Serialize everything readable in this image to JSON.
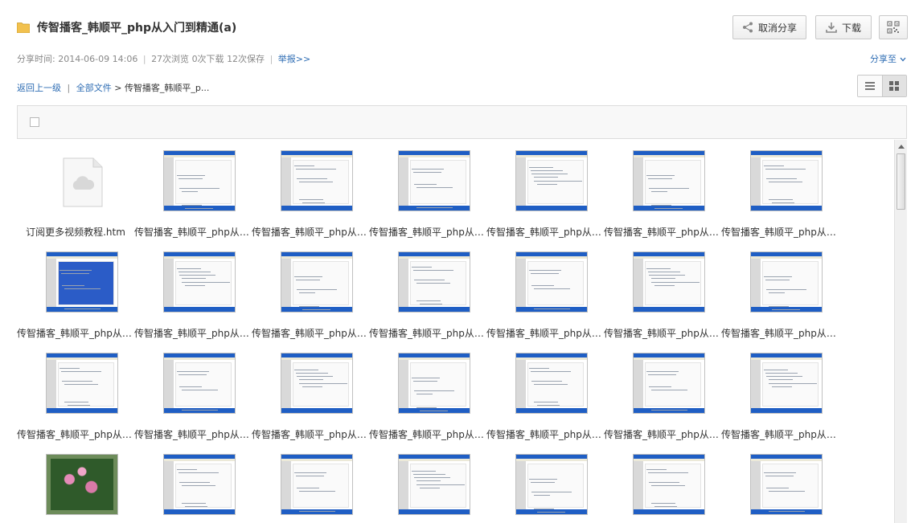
{
  "header": {
    "folder_icon": "folder-icon",
    "title": "传智播客_韩顺平_php从入门到精通(a)",
    "unshare_label": "取消分享",
    "download_label": "下载",
    "qr_icon": "qrcode-icon"
  },
  "meta": {
    "share_time_label": "分享时间:",
    "share_time": "2014-06-09 14:06",
    "views": "27次浏览",
    "downloads": "0次下载",
    "saves": "12次保存",
    "report": "举报>>",
    "share_to": "分享至"
  },
  "breadcrumb": {
    "back": "返回上一级",
    "all_files": "全部文件",
    "arrow": ">",
    "current": "传智播客_韩顺平_p..."
  },
  "colors": {
    "link": "#2d6cb3",
    "folder": "#f2c14e",
    "window_title": "#1f5ec4"
  },
  "files": [
    {
      "name": "订阅更多视频教程.htm",
      "kind": "doc"
    },
    {
      "name": "传智播客_韩顺平_php从入门到精通",
      "kind": "thumb"
    },
    {
      "name": "传智播客_韩顺平_php从入门到精通",
      "kind": "thumb"
    },
    {
      "name": "传智播客_韩顺平_php从入门到精通",
      "kind": "thumb"
    },
    {
      "name": "传智播客_韩顺平_php从入门到精通",
      "kind": "thumb"
    },
    {
      "name": "传智播客_韩顺平_php从入门到精通",
      "kind": "thumb"
    },
    {
      "name": "传智播客_韩顺平_php从入门到精通",
      "kind": "thumb"
    },
    {
      "name": "传智播客_韩顺平_php从入门到精通",
      "kind": "highlight"
    },
    {
      "name": "传智播客_韩顺平_php从入门到精通",
      "kind": "thumb"
    },
    {
      "name": "传智播客_韩顺平_php从入门到精通",
      "kind": "thumb"
    },
    {
      "name": "传智播客_韩顺平_php从入门到精通",
      "kind": "thumb"
    },
    {
      "name": "传智播客_韩顺平_php从入门到精通",
      "kind": "thumb"
    },
    {
      "name": "传智播客_韩顺平_php从入门到精通",
      "kind": "thumb"
    },
    {
      "name": "传智播客_韩顺平_php从入门到精通",
      "kind": "thumb"
    },
    {
      "name": "传智播客_韩顺平_php从入门到精通",
      "kind": "thumb"
    },
    {
      "name": "传智播客_韩顺平_php从入门到精通",
      "kind": "thumb"
    },
    {
      "name": "传智播客_韩顺平_php从入门到精通",
      "kind": "thumb"
    },
    {
      "name": "传智播客_韩顺平_php从入门到精通",
      "kind": "thumb"
    },
    {
      "name": "传智播客_韩顺平_php从入门到精通",
      "kind": "thumb"
    },
    {
      "name": "传智播客_韩顺平_php从入门到精通",
      "kind": "thumb"
    },
    {
      "name": "传智播客_韩顺平_php从入门到精通",
      "kind": "thumb"
    },
    {
      "name": "",
      "kind": "photo"
    },
    {
      "name": "",
      "kind": "thumb"
    },
    {
      "name": "",
      "kind": "thumb"
    },
    {
      "name": "",
      "kind": "thumb"
    },
    {
      "name": "",
      "kind": "thumb"
    },
    {
      "name": "",
      "kind": "thumb"
    },
    {
      "name": "",
      "kind": "thumb"
    }
  ]
}
